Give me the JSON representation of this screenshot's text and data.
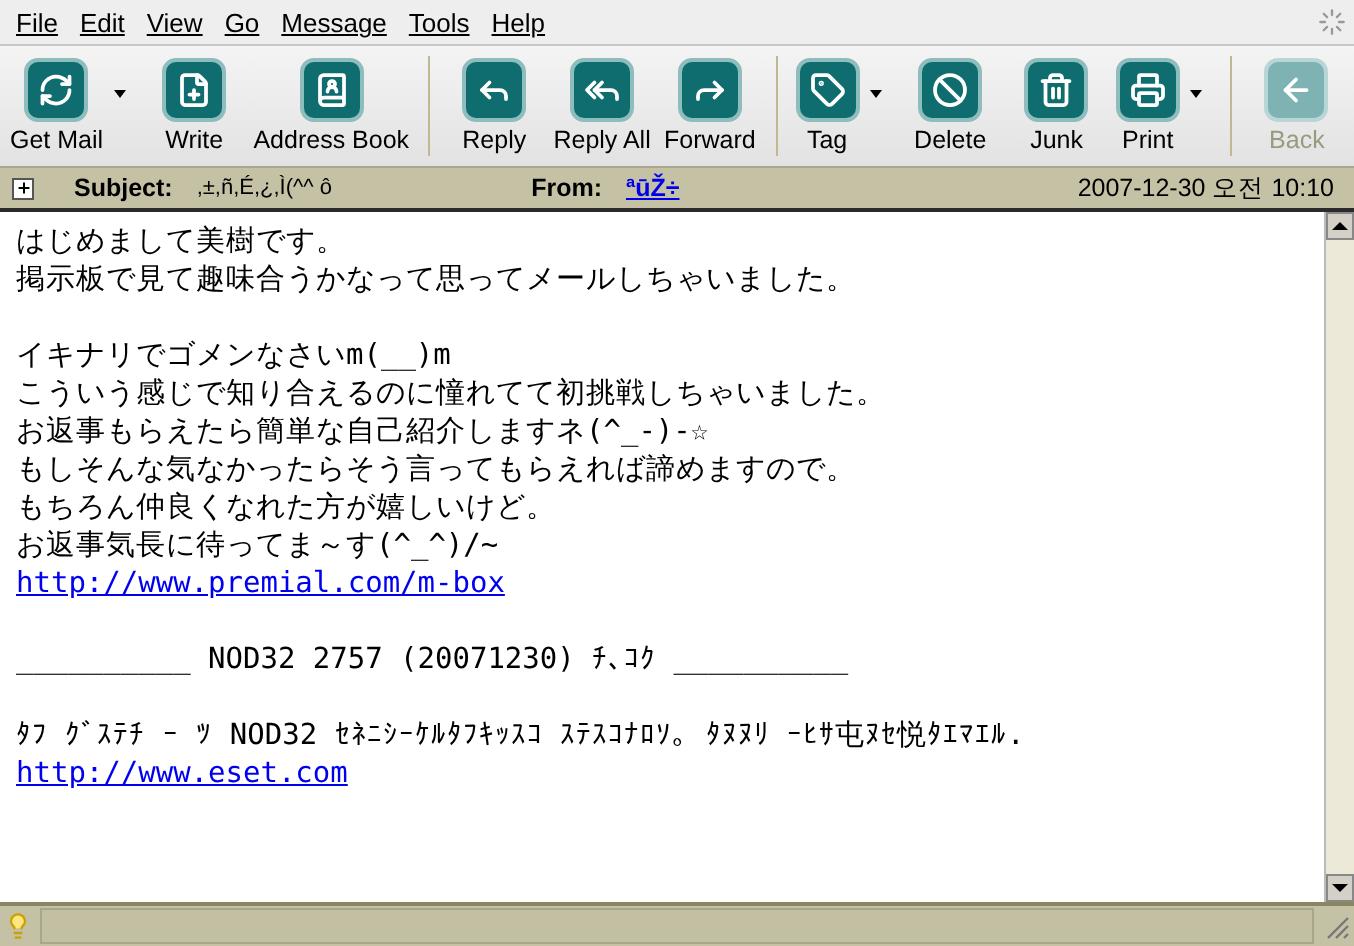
{
  "menu": [
    "File",
    "Edit",
    "View",
    "Go",
    "Message",
    "Tools",
    "Help"
  ],
  "toolbar": [
    {
      "label": "Get Mail",
      "dropdown": true,
      "disabled": false,
      "separator_after": false
    },
    {
      "label": "Write",
      "dropdown": false,
      "disabled": false,
      "separator_after": false
    },
    {
      "label": "Address Book",
      "dropdown": false,
      "disabled": false,
      "separator_after": true
    },
    {
      "label": "Reply",
      "dropdown": false,
      "disabled": false,
      "separator_after": false
    },
    {
      "label": "Reply All",
      "dropdown": false,
      "disabled": false,
      "separator_after": false
    },
    {
      "label": "Forward",
      "dropdown": false,
      "disabled": false,
      "separator_after": true
    },
    {
      "label": "Tag",
      "dropdown": true,
      "disabled": false,
      "separator_after": false
    },
    {
      "label": "Delete",
      "dropdown": false,
      "disabled": false,
      "separator_after": false
    },
    {
      "label": "Junk",
      "dropdown": false,
      "disabled": false,
      "separator_after": false
    },
    {
      "label": "Print",
      "dropdown": true,
      "disabled": false,
      "separator_after": true
    },
    {
      "label": "Back",
      "dropdown": false,
      "disabled": true,
      "separator_after": false
    }
  ],
  "header": {
    "expanded": false,
    "subject_label": "Subject:",
    "subject": ",±,ñ,É,¿,Ì(^^ ô",
    "from_label": "From:",
    "from": "ªūŽ÷",
    "date": "2007-12-30 오전 10:10"
  },
  "body": [
    [
      {
        "kind": "text",
        "text": "はじめまして美樹です。"
      },
      {
        "kind": "text",
        "text": "掲示板で見て趣味合うかなって思ってメールしちゃいました。"
      }
    ],
    [
      {
        "kind": "text",
        "text": "イキナリでゴメンなさいm(__)m"
      },
      {
        "kind": "text",
        "text": "こういう感じで知り合えるのに憧れてて初挑戦しちゃいました。"
      },
      {
        "kind": "text",
        "text": "お返事もらえたら簡単な自己紹介しますネ(^_-)-☆"
      },
      {
        "kind": "text",
        "text": "もしそんな気なかったらそう言ってもらえれば諦めますので。"
      },
      {
        "kind": "text",
        "text": "もちろん仲良くなれた方が嬉しいけど。"
      },
      {
        "kind": "text",
        "text": "お返事気長に待ってま～す(^_^)/~"
      },
      {
        "kind": "link",
        "text": "http://www.premial.com/m-box"
      }
    ],
    [
      {
        "kind": "text",
        "text": "__________ NOD32 2757 (20071230) ﾁ､ｺｸ __________"
      }
    ],
    [
      {
        "kind": "text",
        "text": "ﾀﾌ ｸﾞｽﾃﾁ ｰ ﾂ NOD32 ｾﾈﾆｼｰｹﾙﾀﾌｷｯｽｺ ｽﾃｽｺﾅﾛｿ｡ ﾀﾇﾇﾘ ｰﾋｻ屯ﾇｾ悦ﾀｴﾏｴﾙ."
      },
      {
        "kind": "link",
        "text": "http://www.eset.com"
      }
    ]
  ]
}
